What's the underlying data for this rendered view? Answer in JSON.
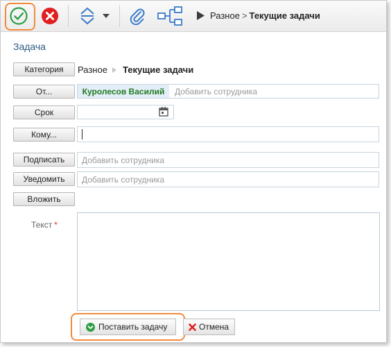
{
  "toolbar": {
    "save_icon": "check-circle-icon",
    "cancel_icon": "close-circle-icon",
    "priority_icon": "sort-arrows-icon",
    "dropdown_icon": "chevron-down-icon",
    "attach_icon": "paperclip-icon",
    "tree_icon": "hierarchy-icon",
    "breadcrumb": {
      "parent": "Разное",
      "separator": ">",
      "current": "Текущие задачи"
    }
  },
  "form": {
    "title": "Задача",
    "category": {
      "button": "Категория",
      "path_parent": "Разное",
      "path_current": "Текущие задачи"
    },
    "from": {
      "button": "От...",
      "selected": "Куролесов Василий",
      "placeholder": "Добавить сотрудника"
    },
    "deadline": {
      "button": "Срок",
      "value": "",
      "icon": "calendar-icon"
    },
    "to": {
      "button": "Кому...",
      "value": ""
    },
    "sign": {
      "button": "Подписать",
      "placeholder": "Добавить сотрудника"
    },
    "notify": {
      "button": "Уведомить",
      "placeholder": "Добавить сотрудника"
    },
    "attach": {
      "button": "Вложить"
    },
    "text": {
      "label": "Текст",
      "required_mark": "*",
      "value": ""
    }
  },
  "actions": {
    "submit": "Поставить задачу",
    "cancel": "Отмена"
  },
  "colors": {
    "highlight": "#f28a3c",
    "title": "#2c5a84",
    "selected_name": "#1f7a1f",
    "save_green": "#2e9e46",
    "cancel_red": "#e02020"
  }
}
